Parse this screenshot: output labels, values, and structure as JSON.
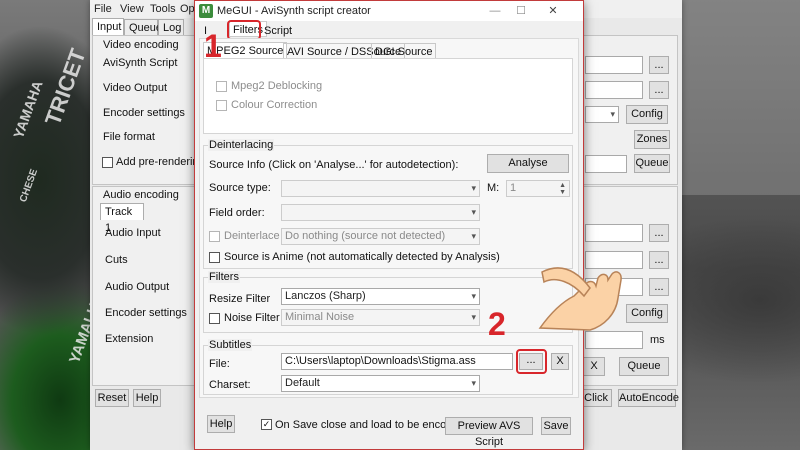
{
  "main_window": {
    "menu": [
      "File",
      "View",
      "Tools",
      "Op"
    ],
    "tabs": [
      "Input",
      "Queue",
      "Log"
    ],
    "video": {
      "group": "Video encoding",
      "rows": [
        "AviSynth Script",
        "Video Output",
        "Encoder settings",
        "File format"
      ],
      "prerender_label": "Add pre-rendering j"
    },
    "audio": {
      "group": "Audio encoding",
      "track_tab": "Track 1",
      "rows": [
        "Audio Input",
        "Cuts",
        "Audio Output",
        "Encoder settings",
        "Extension"
      ]
    },
    "buttons": {
      "browse": "...",
      "config": "Config",
      "zones": "Zones",
      "queue": "Queue",
      "x": "X",
      "ms": "ms",
      "reset": "Reset",
      "help": "Help",
      "oneclick": "e-Click",
      "autoencode": "AutoEncode"
    }
  },
  "dialog": {
    "title": "MeGUI - AviSynth script creator",
    "icon_letter": "M",
    "tabs": [
      "I",
      "Filters",
      "Script"
    ],
    "source_tabs": [
      "MPEG2 Source",
      "AVI Source / DSSource",
      "DGI Source"
    ],
    "mpeg2": {
      "deblocking": "Mpeg2 Deblocking",
      "color_correction": "Colour Correction"
    },
    "deinterlacing": {
      "group": "Deinterlacing",
      "source_info": "Source Info (Click on 'Analyse...' for autodetection):",
      "analyse_button": "Analyse",
      "source_type_label": "Source type:",
      "m_label": "M:",
      "m_value": "1",
      "field_order_label": "Field order:",
      "deinterlace_label": "Deinterlace",
      "deinterlace_value": "Do nothing (source not detected)",
      "anime_label": "Source is Anime (not automatically detected by Analysis)"
    },
    "filters": {
      "group": "Filters",
      "resize_label": "Resize Filter",
      "resize_value": "Lanczos (Sharp)",
      "noise_label": "Noise Filter",
      "noise_value": "Minimal Noise"
    },
    "subtitles": {
      "group": "Subtitles",
      "file_label": "File:",
      "file_value": "C:\\Users\\laptop\\Downloads\\Stigma.ass",
      "browse": "...",
      "clear": "X",
      "charset_label": "Charset:",
      "charset_value": "Default"
    },
    "footer": {
      "help": "Help",
      "onsave_label": "On Save close and load to be encoded",
      "onsave_checked": true,
      "preview": "Preview AVS Script",
      "save": "Save"
    }
  },
  "annotations": {
    "step1": "1",
    "step2": "2",
    "color": "#d8262b"
  },
  "background_text": [
    "TRICET",
    "YAMAHA",
    "YAMALUBE",
    "CHESE"
  ]
}
